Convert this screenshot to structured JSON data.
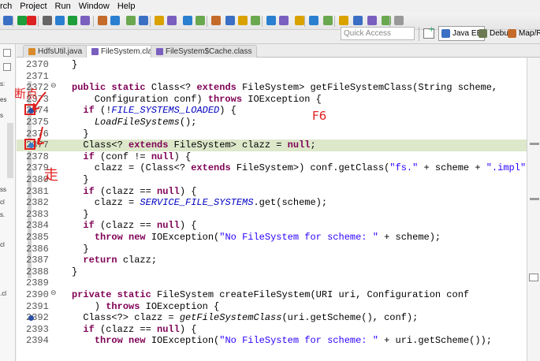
{
  "menubar": {
    "items": [
      "rch",
      "Project",
      "Run",
      "Window",
      "Help"
    ]
  },
  "toolbar": {
    "quick_access_placeholder": "Quick Access",
    "perspectives": [
      {
        "label": "Java EE",
        "color": "#3a6fc4",
        "active": true
      },
      {
        "label": "Debug",
        "color": "#6b7a52",
        "active": false
      },
      {
        "label": "Map/Re",
        "color": "#c46a2a",
        "active": false
      }
    ]
  },
  "left_strip": {
    "fragments": [
      "s:",
      "es",
      "s",
      "ss",
      "cl",
      "s.",
      "cl",
      ".cl"
    ]
  },
  "tabs": [
    {
      "label": "HdfsUtil.java",
      "color": "#d98b2b",
      "active": false
    },
    {
      "label": "FileSystem.class",
      "color": "#7a5fbf",
      "active": true
    },
    {
      "label": "FileSystem$Cache.class",
      "color": "#7a5fbf",
      "active": false
    }
  ],
  "code_lines": [
    {
      "n": "2370",
      "text": "}"
    },
    {
      "n": "2371",
      "text": ""
    },
    {
      "n": "2372",
      "text": "public static Class<? extends FileSystem> getFileSystemClass(String scheme,"
    },
    {
      "n": "2373",
      "text": "    Configuration conf) throws IOException {"
    },
    {
      "n": "2374",
      "text": "  if (!FILE_SYSTEMS_LOADED) {"
    },
    {
      "n": "2375",
      "text": "    LoadFileSystems();"
    },
    {
      "n": "2376",
      "text": "  }"
    },
    {
      "n": "2377",
      "text": "  Class<? extends FileSystem> clazz = null;"
    },
    {
      "n": "2378",
      "text": "  if (conf != null) {"
    },
    {
      "n": "2379",
      "text": "    clazz = (Class<? extends FileSystem>) conf.getClass(\"fs.\" + scheme + \".impl\", null);"
    },
    {
      "n": "2380",
      "text": "  }"
    },
    {
      "n": "2381",
      "text": "  if (clazz == null) {"
    },
    {
      "n": "2382",
      "text": "    clazz = SERVICE_FILE_SYSTEMS.get(scheme);"
    },
    {
      "n": "2383",
      "text": "  }"
    },
    {
      "n": "2384",
      "text": "  if (clazz == null) {"
    },
    {
      "n": "2385",
      "text": "    throw new IOException(\"No FileSystem for scheme: \" + scheme);"
    },
    {
      "n": "2386",
      "text": "  }"
    },
    {
      "n": "2387",
      "text": "  return clazz;"
    },
    {
      "n": "2388",
      "text": "}"
    },
    {
      "n": "2389",
      "text": ""
    },
    {
      "n": "2390",
      "text": "private static FileSystem createFileSystem(URI uri, Configuration conf"
    },
    {
      "n": "2391",
      "text": "    ) throws IOException {"
    },
    {
      "n": "2392",
      "text": "  Class<?> clazz = getFileSystemClass(uri.getScheme(), conf);"
    },
    {
      "n": "2393",
      "text": "  if (clazz == null) {"
    },
    {
      "n": "2394",
      "text": "    throw new IOException(\"No FileSystem for scheme: \" + uri.getScheme());"
    }
  ],
  "annotations": {
    "breakpoint_note": "断点",
    "step_note": "走",
    "f6_label": "F6"
  },
  "colors": {
    "keyword": "#7f0055",
    "string": "#2a00ff",
    "static_italic": "#0000c0",
    "current_line": "#dde7ca",
    "annotation_red": "#e02020"
  }
}
